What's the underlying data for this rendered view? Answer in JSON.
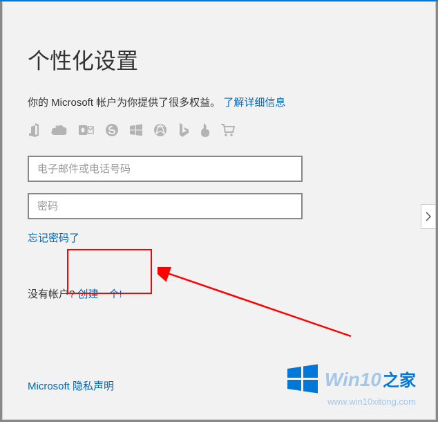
{
  "title": "个性化设置",
  "subtitle_prefix": "你的 Microsoft 帐户为你提供了很多权益。",
  "learn_more": "了解详细信息",
  "inputs": {
    "email_placeholder": "电子邮件或电话号码",
    "password_placeholder": "密码"
  },
  "forgot_password": "忘记密码了",
  "no_account_prefix": "没有帐户? ",
  "create_one": "创建一个!",
  "privacy": "Microsoft 隐私声明",
  "branding": {
    "text_main": "Win10",
    "text_suffix": "之家",
    "url": "www.win10xitong.com"
  },
  "icons": [
    "office-icon",
    "onedrive-icon",
    "outlook-icon",
    "skype-icon",
    "windows-icon",
    "xbox-icon",
    "bing-icon",
    "flame-icon",
    "cart-icon"
  ]
}
